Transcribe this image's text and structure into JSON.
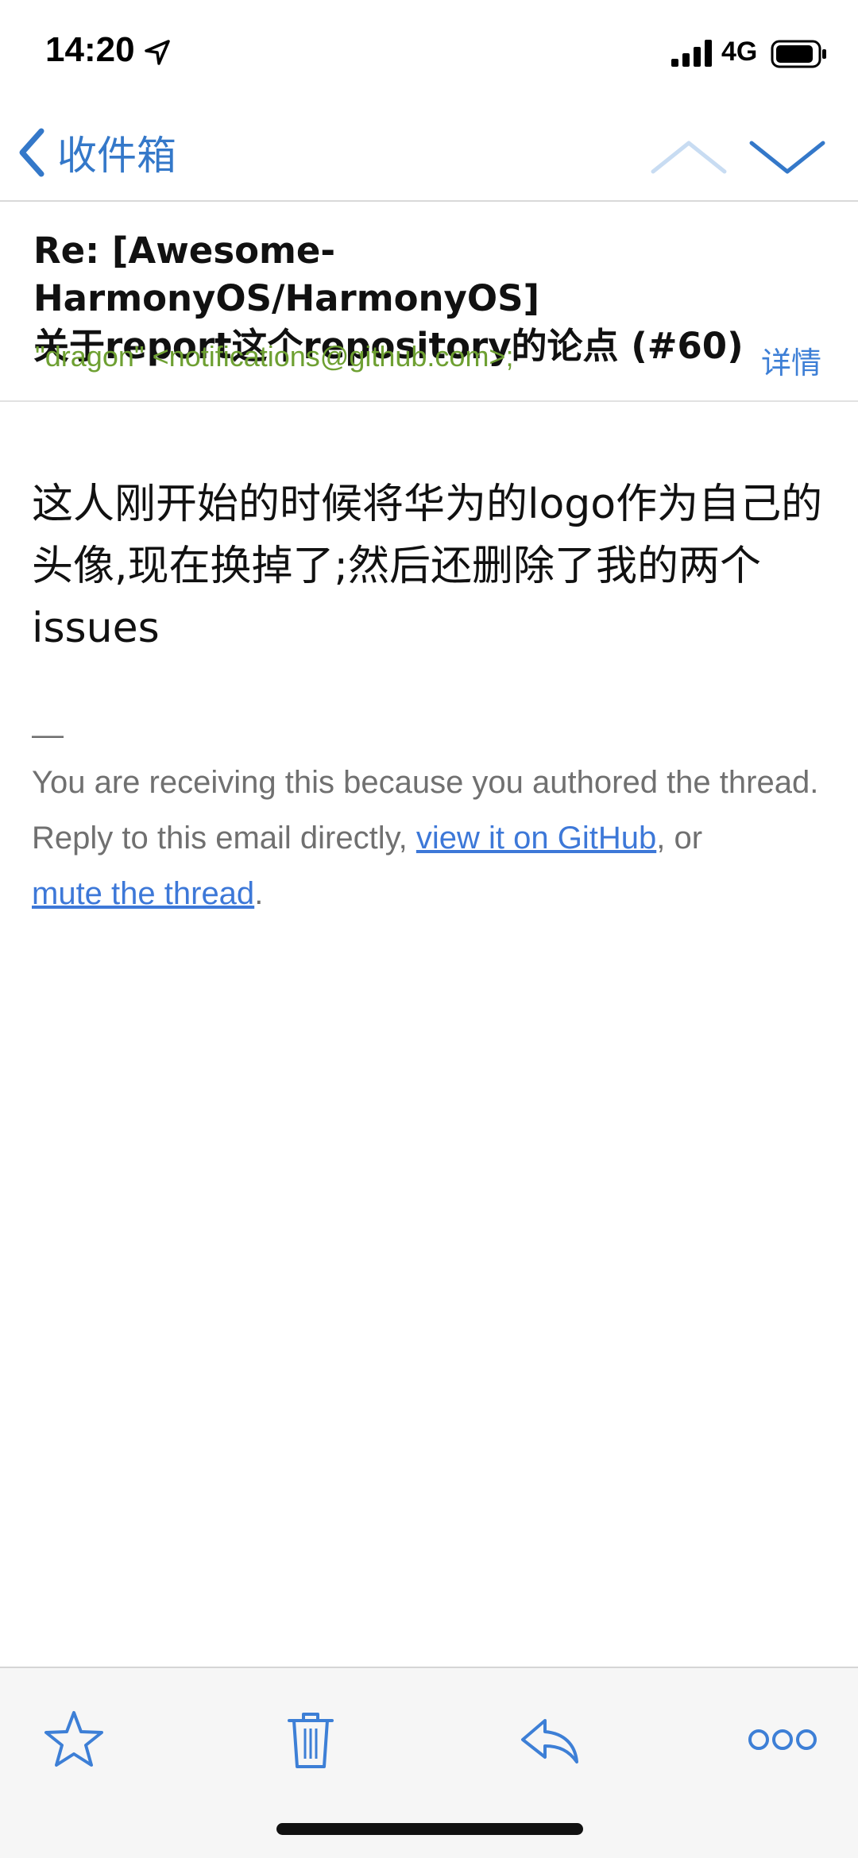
{
  "status_bar": {
    "time": "14:20",
    "network": "4G",
    "icons": [
      "location-arrow-icon",
      "signal-icon",
      "battery-icon"
    ]
  },
  "nav": {
    "back_label": "收件箱",
    "icons": [
      "chevron-left-icon",
      "chevron-up-icon",
      "chevron-down-icon"
    ],
    "up_enabled": false,
    "down_enabled": true
  },
  "message": {
    "subject_line1": "Re: [Awesome-HarmonyOS/HarmonyOS]",
    "subject_line2": "关于report这个repository的论点 (#60)",
    "sender": "\"dragon\" <notifications@github.com>;",
    "details_label": "详情",
    "body": "这人刚开始的时候将华为的logo作为自己的头像,现在换掉了;然后还删除了我的两个issues",
    "footer_dash": "—",
    "footer_line1": "You are receiving this because you authored the thread.",
    "footer_line2_prefix": "Reply to this email directly, ",
    "footer_link1": "view it on GitHub",
    "footer_line2_mid": ", or",
    "footer_link2": "mute the thread",
    "footer_line2_suffix": "."
  },
  "toolbar": {
    "icons": [
      "star-icon",
      "trash-icon",
      "reply-icon",
      "more-icon"
    ]
  },
  "colors": {
    "accent": "#3478c9",
    "sender": "#6ea032",
    "footer_text": "#707070",
    "link": "#3d78d8"
  }
}
